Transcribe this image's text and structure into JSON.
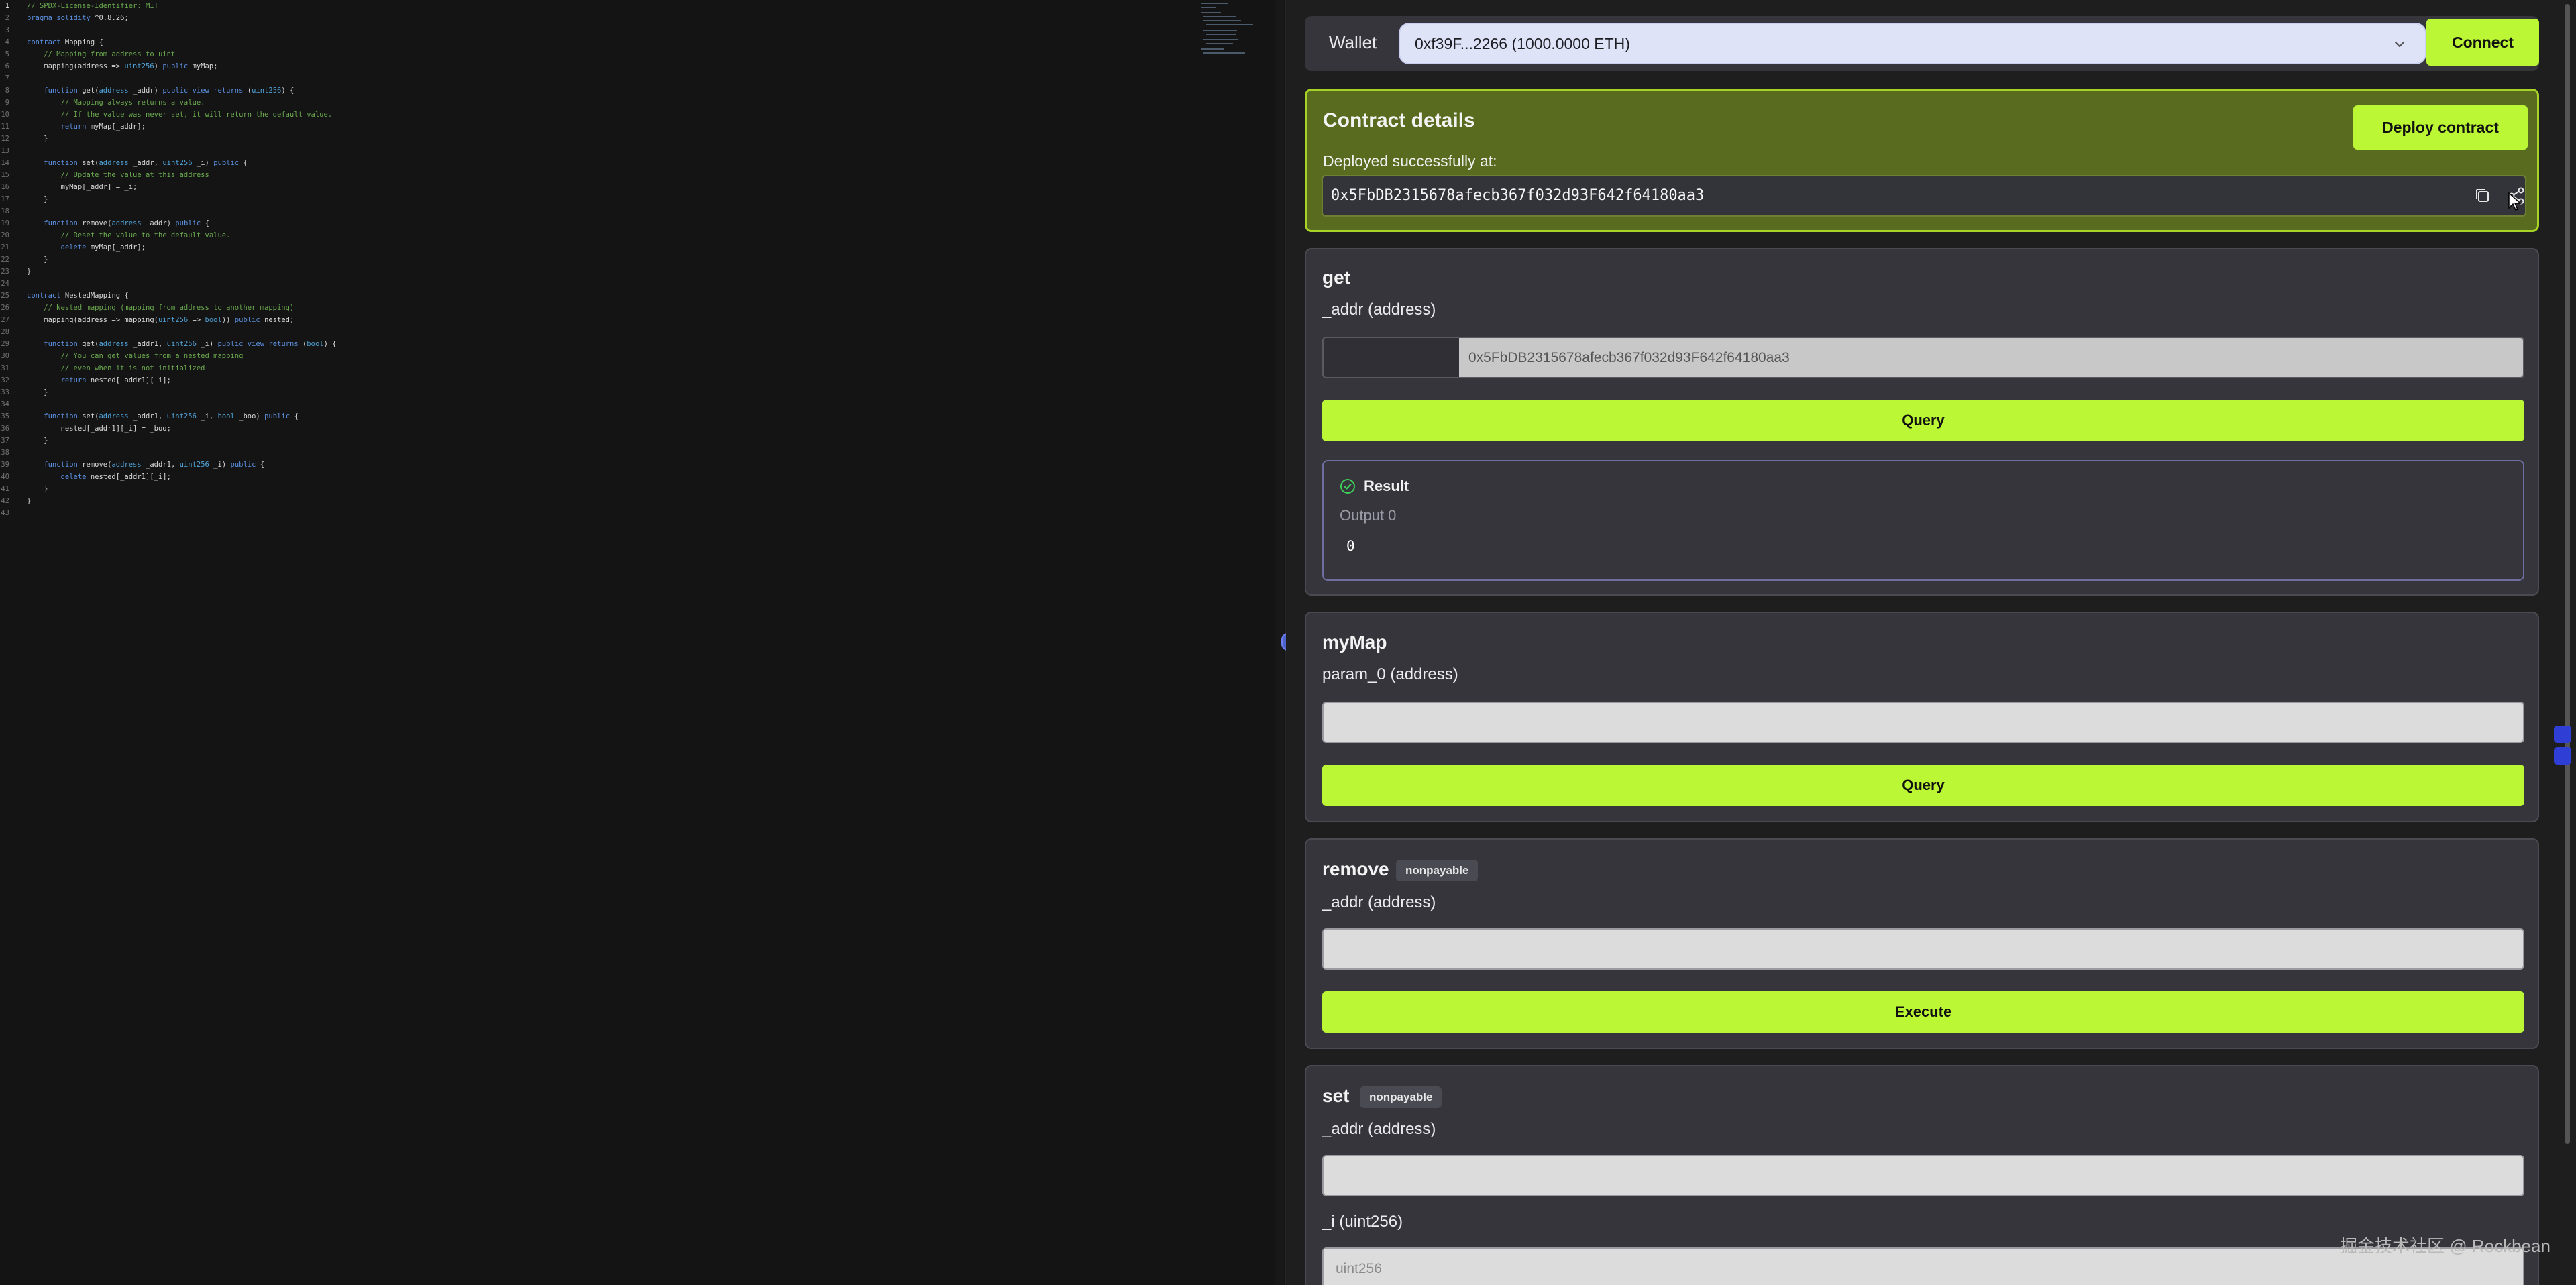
{
  "editor": {
    "lines": [
      {
        "n": "1",
        "segs": [
          {
            "t": "// SPDX-License-Identifier: MIT",
            "c": "com"
          }
        ]
      },
      {
        "n": "2",
        "segs": [
          {
            "t": "pragma solidity ",
            "c": "kw"
          },
          {
            "t": "^0.8.26;",
            "c": ""
          }
        ]
      },
      {
        "n": "3",
        "segs": []
      },
      {
        "n": "4",
        "segs": [
          {
            "t": "contract ",
            "c": "kw"
          },
          {
            "t": "Mapping {",
            "c": ""
          }
        ]
      },
      {
        "n": "5",
        "segs": [
          {
            "t": "    // Mapping from address to uint",
            "c": "com"
          }
        ]
      },
      {
        "n": "6",
        "segs": [
          {
            "t": "    mapping(address => ",
            "c": ""
          },
          {
            "t": "uint256",
            "c": "ty"
          },
          {
            "t": ") ",
            "c": ""
          },
          {
            "t": "public ",
            "c": "kw"
          },
          {
            "t": "myMap;",
            "c": ""
          }
        ]
      },
      {
        "n": "7",
        "segs": []
      },
      {
        "n": "8",
        "segs": [
          {
            "t": "    function ",
            "c": "kw"
          },
          {
            "t": "get(",
            "c": ""
          },
          {
            "t": "address",
            "c": "ty"
          },
          {
            "t": " _addr) ",
            "c": ""
          },
          {
            "t": "public view returns ",
            "c": "kw"
          },
          {
            "t": "(",
            "c": ""
          },
          {
            "t": "uint256",
            "c": "ty"
          },
          {
            "t": ") {",
            "c": ""
          }
        ]
      },
      {
        "n": "9",
        "segs": [
          {
            "t": "        // Mapping always returns a value.",
            "c": "com"
          }
        ]
      },
      {
        "n": "10",
        "segs": [
          {
            "t": "        // If the value was never set, it will return the default value.",
            "c": "com"
          }
        ]
      },
      {
        "n": "11",
        "segs": [
          {
            "t": "        return ",
            "c": "kw"
          },
          {
            "t": "myMap[_addr];",
            "c": ""
          }
        ]
      },
      {
        "n": "12",
        "segs": [
          {
            "t": "    }",
            "c": ""
          }
        ]
      },
      {
        "n": "13",
        "segs": []
      },
      {
        "n": "14",
        "segs": [
          {
            "t": "    function ",
            "c": "kw"
          },
          {
            "t": "set(",
            "c": ""
          },
          {
            "t": "address",
            "c": "ty"
          },
          {
            "t": " _addr, ",
            "c": ""
          },
          {
            "t": "uint256",
            "c": "ty"
          },
          {
            "t": " _i) ",
            "c": ""
          },
          {
            "t": "public ",
            "c": "kw"
          },
          {
            "t": "{",
            "c": ""
          }
        ]
      },
      {
        "n": "15",
        "segs": [
          {
            "t": "        // Update the value at this address",
            "c": "com"
          }
        ]
      },
      {
        "n": "16",
        "segs": [
          {
            "t": "        myMap[_addr] = _i;",
            "c": ""
          }
        ]
      },
      {
        "n": "17",
        "segs": [
          {
            "t": "    }",
            "c": ""
          }
        ]
      },
      {
        "n": "18",
        "segs": []
      },
      {
        "n": "19",
        "segs": [
          {
            "t": "    function ",
            "c": "kw"
          },
          {
            "t": "remove(",
            "c": ""
          },
          {
            "t": "address",
            "c": "ty"
          },
          {
            "t": " _addr) ",
            "c": ""
          },
          {
            "t": "public ",
            "c": "kw"
          },
          {
            "t": "{",
            "c": ""
          }
        ]
      },
      {
        "n": "20",
        "segs": [
          {
            "t": "        // Reset the value to the default value.",
            "c": "com"
          }
        ]
      },
      {
        "n": "21",
        "segs": [
          {
            "t": "        delete ",
            "c": "kw"
          },
          {
            "t": "myMap[_addr];",
            "c": ""
          }
        ]
      },
      {
        "n": "22",
        "segs": [
          {
            "t": "    }",
            "c": ""
          }
        ]
      },
      {
        "n": "23",
        "segs": [
          {
            "t": "}",
            "c": ""
          }
        ]
      },
      {
        "n": "24",
        "segs": []
      },
      {
        "n": "25",
        "segs": [
          {
            "t": "contract ",
            "c": "kw"
          },
          {
            "t": "NestedMapping {",
            "c": ""
          }
        ]
      },
      {
        "n": "26",
        "segs": [
          {
            "t": "    // Nested mapping (mapping from address to another mapping)",
            "c": "com"
          }
        ]
      },
      {
        "n": "27",
        "segs": [
          {
            "t": "    mapping(address => mapping(",
            "c": ""
          },
          {
            "t": "uint256",
            "c": "ty"
          },
          {
            "t": " => ",
            "c": ""
          },
          {
            "t": "bool",
            "c": "ty"
          },
          {
            "t": ")) ",
            "c": ""
          },
          {
            "t": "public ",
            "c": "kw"
          },
          {
            "t": "nested;",
            "c": ""
          }
        ]
      },
      {
        "n": "28",
        "segs": []
      },
      {
        "n": "29",
        "segs": [
          {
            "t": "    function ",
            "c": "kw"
          },
          {
            "t": "get(",
            "c": ""
          },
          {
            "t": "address",
            "c": "ty"
          },
          {
            "t": " _addr1, ",
            "c": ""
          },
          {
            "t": "uint256",
            "c": "ty"
          },
          {
            "t": " _i) ",
            "c": ""
          },
          {
            "t": "public view returns ",
            "c": "kw"
          },
          {
            "t": "(",
            "c": ""
          },
          {
            "t": "bool",
            "c": "ty"
          },
          {
            "t": ") {",
            "c": ""
          }
        ]
      },
      {
        "n": "30",
        "segs": [
          {
            "t": "        // You can get values from a nested mapping",
            "c": "com"
          }
        ]
      },
      {
        "n": "31",
        "segs": [
          {
            "t": "        // even when it is not initialized",
            "c": "com"
          }
        ]
      },
      {
        "n": "32",
        "segs": [
          {
            "t": "        return ",
            "c": "kw"
          },
          {
            "t": "nested[_addr1][_i];",
            "c": ""
          }
        ]
      },
      {
        "n": "33",
        "segs": [
          {
            "t": "    }",
            "c": ""
          }
        ]
      },
      {
        "n": "34",
        "segs": []
      },
      {
        "n": "35",
        "segs": [
          {
            "t": "    function ",
            "c": "kw"
          },
          {
            "t": "set(",
            "c": ""
          },
          {
            "t": "address",
            "c": "ty"
          },
          {
            "t": " _addr1, ",
            "c": ""
          },
          {
            "t": "uint256",
            "c": "ty"
          },
          {
            "t": " _i, ",
            "c": ""
          },
          {
            "t": "bool",
            "c": "ty"
          },
          {
            "t": " _boo) ",
            "c": ""
          },
          {
            "t": "public ",
            "c": "kw"
          },
          {
            "t": "{",
            "c": ""
          }
        ]
      },
      {
        "n": "36",
        "segs": [
          {
            "t": "        nested[_addr1][_i] = _boo;",
            "c": ""
          }
        ]
      },
      {
        "n": "37",
        "segs": [
          {
            "t": "    }",
            "c": ""
          }
        ]
      },
      {
        "n": "38",
        "segs": []
      },
      {
        "n": "39",
        "segs": [
          {
            "t": "    function ",
            "c": "kw"
          },
          {
            "t": "remove(",
            "c": ""
          },
          {
            "t": "address",
            "c": "ty"
          },
          {
            "t": " _addr1, ",
            "c": ""
          },
          {
            "t": "uint256",
            "c": "ty"
          },
          {
            "t": " _i) ",
            "c": ""
          },
          {
            "t": "public ",
            "c": "kw"
          },
          {
            "t": "{",
            "c": ""
          }
        ]
      },
      {
        "n": "40",
        "segs": [
          {
            "t": "        delete ",
            "c": "kw"
          },
          {
            "t": "nested[_addr1][_i];",
            "c": ""
          }
        ]
      },
      {
        "n": "41",
        "segs": [
          {
            "t": "    }",
            "c": ""
          }
        ]
      },
      {
        "n": "42",
        "segs": [
          {
            "t": "}",
            "c": ""
          }
        ]
      },
      {
        "n": "43",
        "segs": []
      }
    ]
  },
  "wallet": {
    "label": "Wallet",
    "selected": "0xf39F...2266 (1000.0000 ETH)",
    "connect_label": "Connect"
  },
  "contract": {
    "title": "Contract details",
    "deploy_label": "Deploy contract",
    "deployed_label": "Deployed successfully at:",
    "address": "0x5FbDB2315678afecb367f032d93F642f64180aa3"
  },
  "functions": {
    "get": {
      "name": "get",
      "param_label": "_addr (address)",
      "input_value": "0x5FbDB2315678afecb367f032d93F642f64180aa3",
      "button": "Query",
      "result_title": "Result",
      "output_label": "Output 0",
      "output_value": "0"
    },
    "myMap": {
      "name": "myMap",
      "param_label": "param_0 (address)",
      "button": "Query"
    },
    "remove": {
      "name": "remove",
      "badge": "nonpayable",
      "param_label": "_addr (address)",
      "button": "Execute"
    },
    "set": {
      "name": "set",
      "badge": "nonpayable",
      "param1_label": "_addr (address)",
      "param2_label": "_i (uint256)",
      "param2_placeholder": "uint256"
    }
  },
  "watermark": "掘金技术社区 @ Rockbean",
  "colors": {
    "accent_lime": "#bbf734",
    "contract_bg": "#596b1f",
    "card_bg": "#35353b",
    "comment": "#6aa84f",
    "keyword": "#5b8fe0"
  },
  "icons": {
    "copy": "copy-icon",
    "share": "share-icon",
    "result": "check-circle-icon",
    "select": "chevron-down-icon"
  }
}
